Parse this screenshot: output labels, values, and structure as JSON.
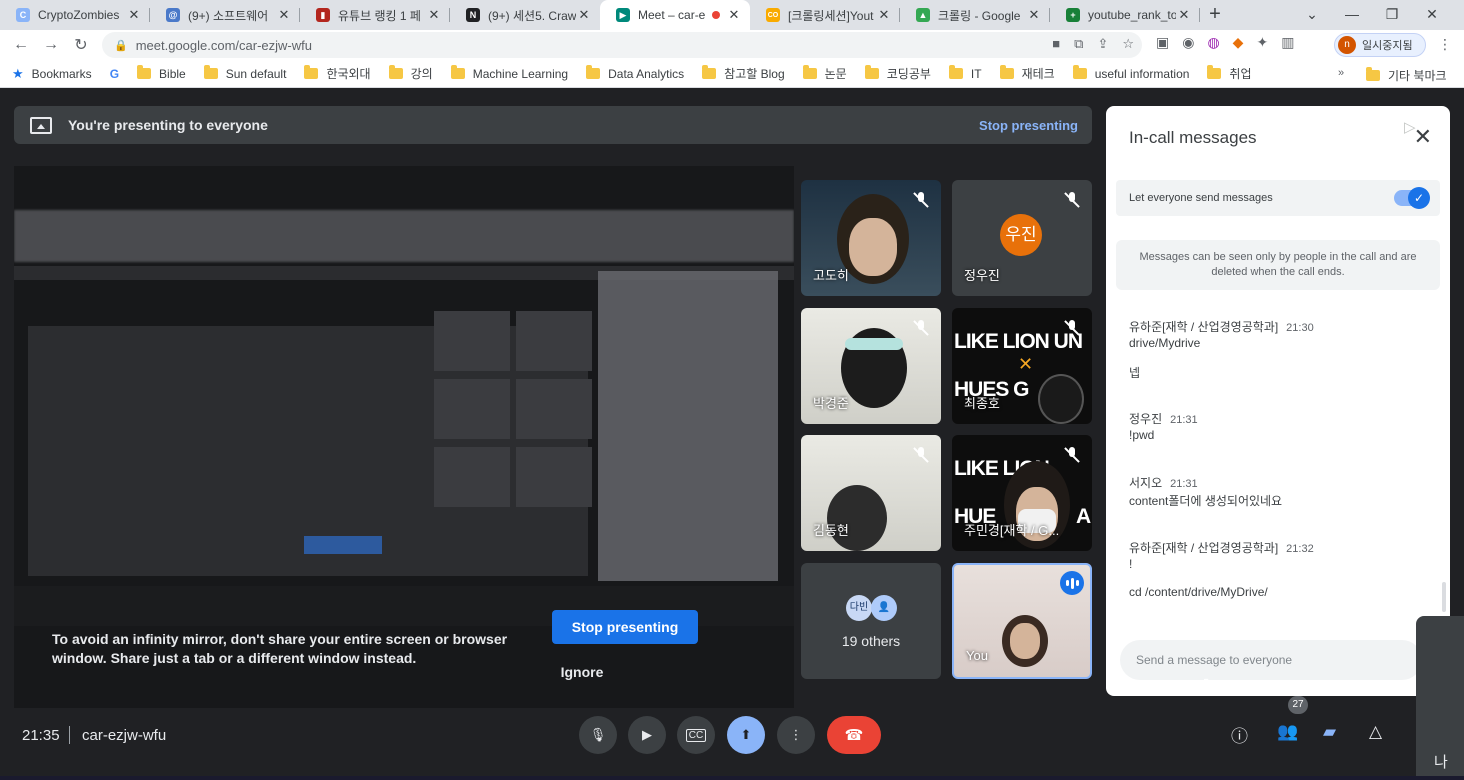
{
  "tabs": [
    {
      "title": "CryptoZombies",
      "color": "#8ab4f8",
      "glyph": "C"
    },
    {
      "title": "(9+) 소프트웨어",
      "color": "#4a79c9",
      "glyph": "@"
    },
    {
      "title": "유튜브 랭킹 1 페",
      "color": "#b3261e",
      "glyph": "▮"
    },
    {
      "title": "(9+) 세션5. Craw",
      "color": "#202124",
      "glyph": "N"
    },
    {
      "title": "Meet – car-e",
      "color": "#00897b",
      "glyph": "▶"
    },
    {
      "title": "[크롤링세션]Yout",
      "color": "#f9ab00",
      "glyph": "CO"
    },
    {
      "title": "크롤링 - Google",
      "color": "#34a853",
      "glyph": "▲"
    },
    {
      "title": "youtube_rank_to",
      "color": "#188038",
      "glyph": "+"
    }
  ],
  "tab_close": "✕",
  "new_tab": "+",
  "window_controls": [
    "⌄",
    "—",
    "❐",
    "✕"
  ],
  "nav": {
    "back": "←",
    "forward": "→",
    "reload": "↻"
  },
  "url": "meet.google.com/car-ezjw-wfu",
  "profile": {
    "initial": "n",
    "label": "일시중지됨"
  },
  "bookmarks": {
    "label": "Bookmarks",
    "google": "G",
    "folders": [
      "Bible",
      "Sun default",
      "한국외대",
      "강의",
      "Machine Learning",
      "Data Analytics",
      "참고할 Blog",
      "논문",
      "코딩공부",
      "IT",
      "재테크",
      "useful information",
      "취업"
    ],
    "more": "»",
    "other": "기타 북마크"
  },
  "presenting": {
    "text": "You're presenting to everyone",
    "stop": "Stop presenting"
  },
  "warning": {
    "text": "To avoid an infinity mirror, don't share your entire screen or browser window. Share just a tab or a different window instead.",
    "stop_button": "Stop presenting",
    "ignore": "Ignore"
  },
  "participants": [
    {
      "name": "고도히",
      "muted": true
    },
    {
      "name": "정우진",
      "avatar": "우진",
      "muted": true
    },
    {
      "name": "박경준",
      "muted": true
    },
    {
      "name": "최종호",
      "brand": "LIKE LION UN",
      "brand2": "HUES G",
      "muted": true
    },
    {
      "name": "김동현",
      "muted": true
    },
    {
      "name": "주민경[재학 / G...",
      "brand": "LIKE LION",
      "brand2": "HUE",
      "brand3": "A",
      "muted": true
    },
    {
      "name": "19 others",
      "avatars": [
        "다빈",
        "👤"
      ]
    },
    {
      "name": "You",
      "speaking": true
    }
  ],
  "chat": {
    "title": "In-call messages",
    "close": "✕",
    "toggle_label": "Let everyone send messages",
    "notice": "Messages can be seen only by people in the call and are deleted when the call ends.",
    "messages": [
      {
        "sender": "유하준[재학 / 산업경영공학과]",
        "time": "21:30",
        "lines": [
          "drive/Mydrive",
          "넵"
        ]
      },
      {
        "sender": "정우진",
        "time": "21:31",
        "lines": [
          "!pwd"
        ]
      },
      {
        "sender": "서지오",
        "time": "21:31",
        "lines": [
          "content폴더에 생성되어있네요"
        ]
      },
      {
        "sender": "유하준[재학 / 산업경영공학과]",
        "time": "21:32",
        "lines": [
          "!",
          "cd /content/drive/MyDrive/"
        ]
      }
    ],
    "input_placeholder": "Send a message to everyone",
    "send_icon": "▷"
  },
  "bottom": {
    "time": "21:35",
    "meeting_code": "car-ezjw-wfu",
    "participants_count": "27",
    "side_label": "나"
  },
  "colors": {
    "accent": "#1a73e8",
    "hangup": "#ea4335",
    "panel_bg": "#ffffff",
    "stage_bg": "#202124"
  }
}
